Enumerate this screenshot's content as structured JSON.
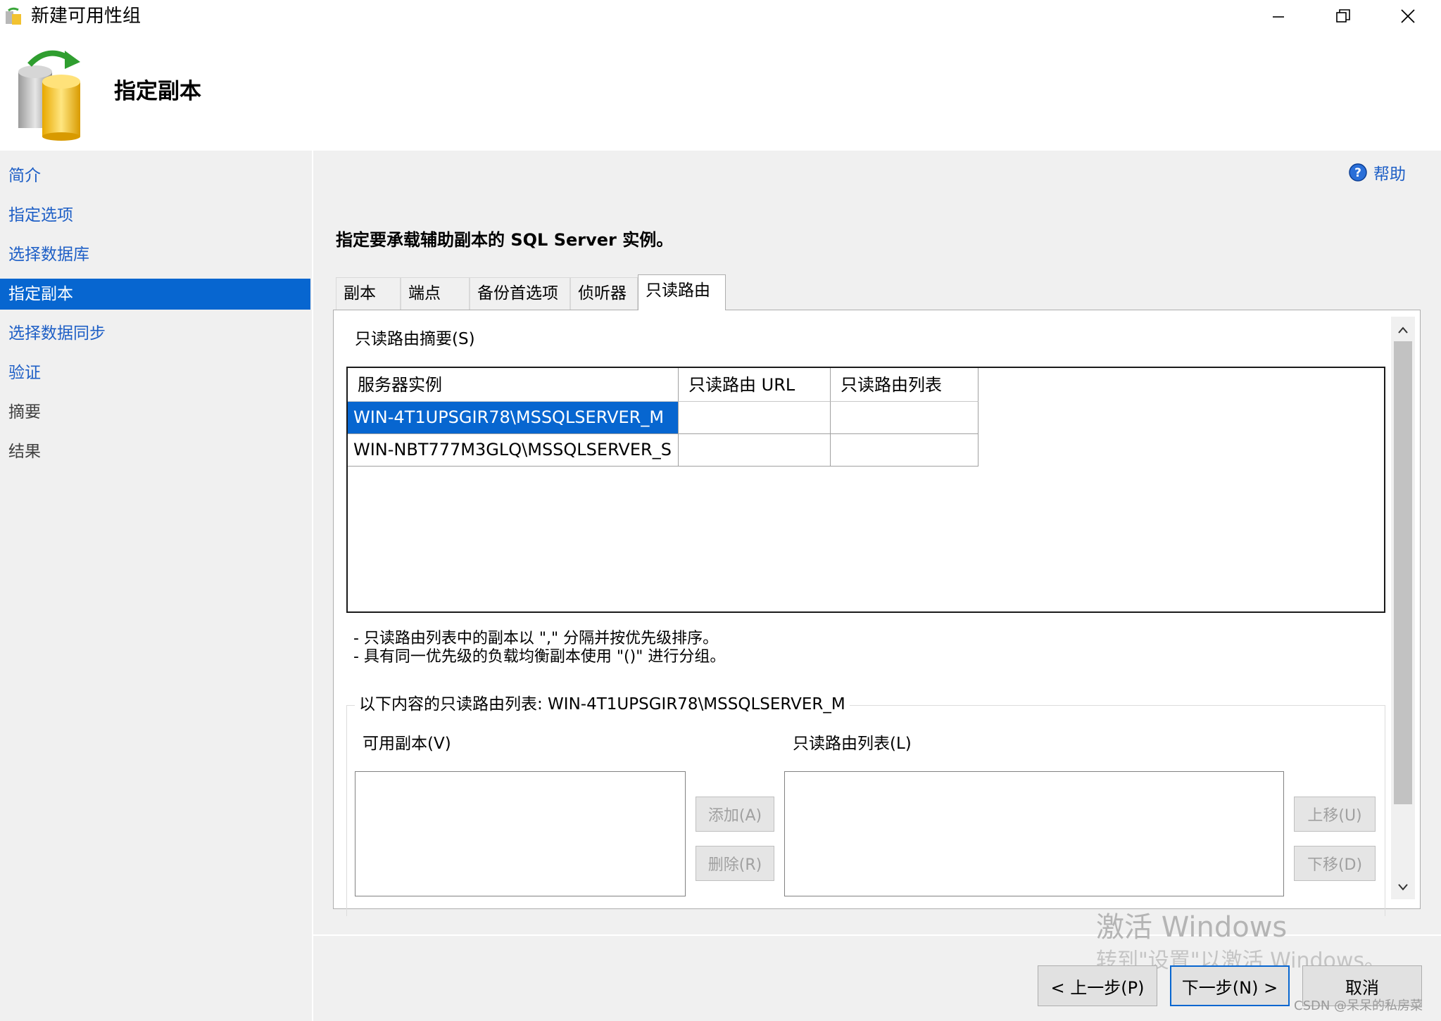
{
  "window": {
    "title": "新建可用性组",
    "minimize": "—",
    "maximize": "❐",
    "close": "✕"
  },
  "header": {
    "title": "指定副本"
  },
  "nav": {
    "items": [
      {
        "label": "简介"
      },
      {
        "label": "指定选项"
      },
      {
        "label": "选择数据库"
      },
      {
        "label": "指定副本"
      },
      {
        "label": "选择数据同步"
      },
      {
        "label": "验证"
      },
      {
        "label": "摘要"
      },
      {
        "label": "结果"
      }
    ]
  },
  "help": {
    "label": "帮助"
  },
  "main": {
    "heading": "指定要承载辅助副本的 SQL Server 实例。",
    "tabs": [
      {
        "label": "副本"
      },
      {
        "label": "端点"
      },
      {
        "label": "备份首选项"
      },
      {
        "label": "侦听器"
      },
      {
        "label": "只读路由"
      }
    ],
    "summary_label": "只读路由摘要(S)",
    "grid": {
      "columns": [
        "服务器实例",
        "只读路由 URL",
        "只读路由列表"
      ],
      "rows": [
        [
          "WIN-4T1UPSGIR78\\MSSQLSERVER_M",
          "",
          ""
        ],
        [
          "WIN-NBT777M3GLQ\\MSSQLSERVER_S",
          "",
          ""
        ]
      ]
    },
    "notes": [
      "- 只读路由列表中的副本以 \",\" 分隔并按优先级排序。",
      "- 具有同一优先级的负载均衡副本使用 \"()\" 进行分组。"
    ],
    "group_title": "以下内容的只读路由列表: WIN-4T1UPSGIR78\\MSSQLSERVER_M",
    "available_label": "可用副本(V)",
    "routing_list_label": "只读路由列表(L)",
    "add_button": "添加(A)",
    "remove_button": "删除(R)",
    "up_button": "上移(U)",
    "down_button": "下移(D)"
  },
  "footer": {
    "prev_button": "< 上一步(P)",
    "next_button": "下一步(N) >",
    "cancel_button": "取消"
  },
  "overlay": {
    "activate_title": "激活 Windows",
    "activate_sub": "转到\"设置\"以激活 Windows。",
    "csdn": "CSDN @呆呆的私房菜"
  },
  "colors": {
    "accent": "#0766d0",
    "link": "#1e5fc6"
  }
}
